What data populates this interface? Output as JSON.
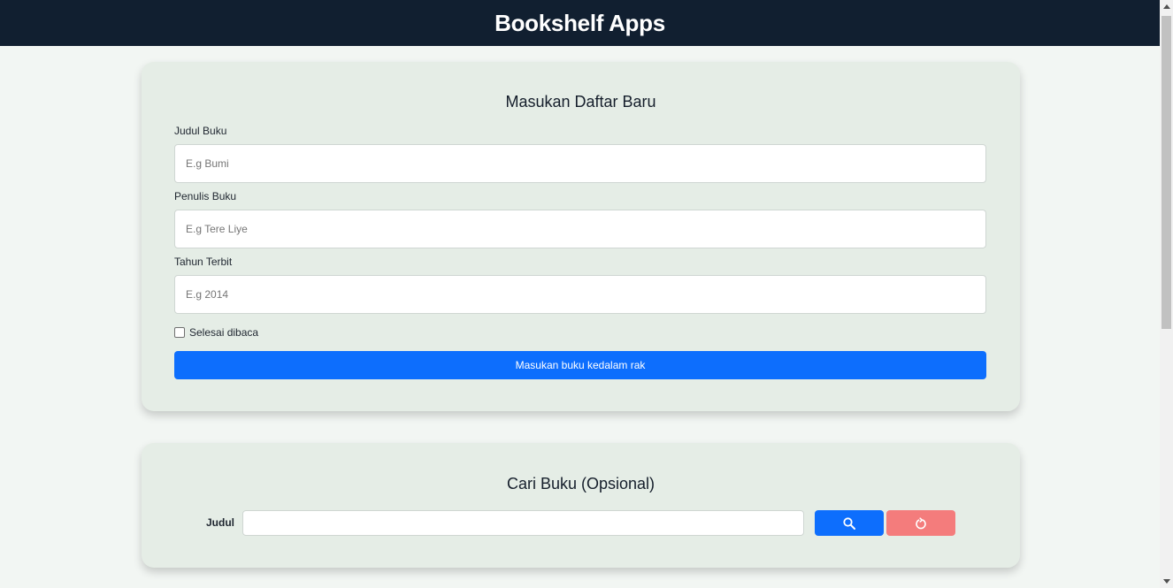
{
  "header": {
    "title": "Bookshelf Apps"
  },
  "form": {
    "title": "Masukan Daftar Baru",
    "fields": [
      {
        "label": "Judul Buku",
        "placeholder": "E.g Bumi"
      },
      {
        "label": "Penulis Buku",
        "placeholder": "E.g Tere Liye"
      },
      {
        "label": "Tahun Terbit",
        "placeholder": "E.g 2014"
      }
    ],
    "checkbox_label": "Selesai dibaca",
    "checkbox_checked": false,
    "submit_label": "Masukan buku kedalam rak"
  },
  "search": {
    "title": "Cari Buku (Opsional)",
    "label": "Judul",
    "value": "",
    "search_icon": "search-icon",
    "reset_icon": "reset-icon"
  },
  "colors": {
    "header_bg": "#111f30",
    "page_bg": "#f2f6f3",
    "card_bg": "#e5ede6",
    "primary": "#0d6efd",
    "reset": "#f47c7c"
  }
}
